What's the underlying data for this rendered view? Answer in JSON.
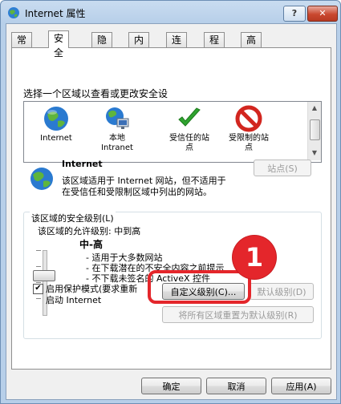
{
  "window": {
    "title": "Internet 属性",
    "help_label": "?",
    "close_label": "✕"
  },
  "tabs": [
    "常规",
    "安全",
    "隐私",
    "内容",
    "连接",
    "程序",
    "高级"
  ],
  "active_tab": "安全",
  "security": {
    "zone_prompt": "选择一个区域以查看或更改安全设",
    "zones": [
      {
        "name": "Internet",
        "icon": "globe-icon"
      },
      {
        "name": "本地\nIntranet",
        "icon": "local-intranet-icon"
      },
      {
        "name": "受信任的站\n点",
        "icon": "checkmark-icon"
      },
      {
        "name": "受限制的站\n点",
        "icon": "restricted-icon"
      }
    ],
    "selected_zone_title": "Internet",
    "selected_zone_desc_1": "该区域适用于 Internet 网站，但不适用于",
    "selected_zone_desc_2": "在受信任和受限制区域中列出的网站。",
    "sites_button": "站点(S)",
    "level_group_label": "该区域的安全级别(L)",
    "allowed_levels": "该区域的允许级别: 中到高",
    "level_name": "中-高",
    "level_bullets": [
      "- 适用于大多数网站",
      "- 在下载潜在的不安全内容之前提示",
      "- 不下载未签名的 ActiveX 控件"
    ],
    "protected_mode_1": "启用保护模式(要求重新",
    "protected_mode_2": "启动 Internet",
    "protected_mode_checked": true,
    "custom_level_button": "自定义级别(C)...",
    "default_level_button": "默认级别(D)",
    "reset_all_button": "将所有区域重置为默认级别(R)"
  },
  "footer": {
    "ok": "确定",
    "cancel": "取消",
    "apply": "应用(A)"
  },
  "annotation": {
    "number": "1",
    "color": "#e4262b"
  }
}
